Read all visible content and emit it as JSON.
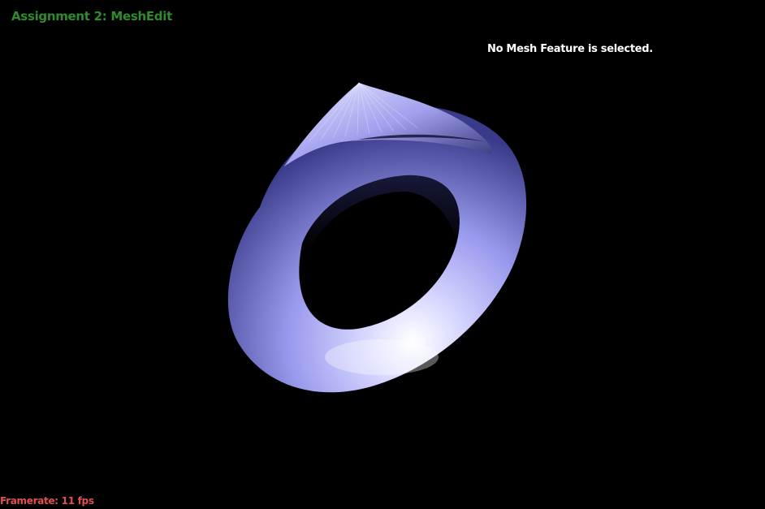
{
  "app": {
    "title": "Assignment 2: MeshEdit",
    "title_color": "#2e8b2e"
  },
  "status": {
    "message": "No Mesh Feature is selected.",
    "color": "#ffffff"
  },
  "footer": {
    "framerate_label": "Framerate: 11 fps",
    "color": "#e05050"
  },
  "viewport": {
    "background": "#000000",
    "mesh_color": "#8c8cff",
    "mesh_shape": "torus-with-pinched-top"
  }
}
